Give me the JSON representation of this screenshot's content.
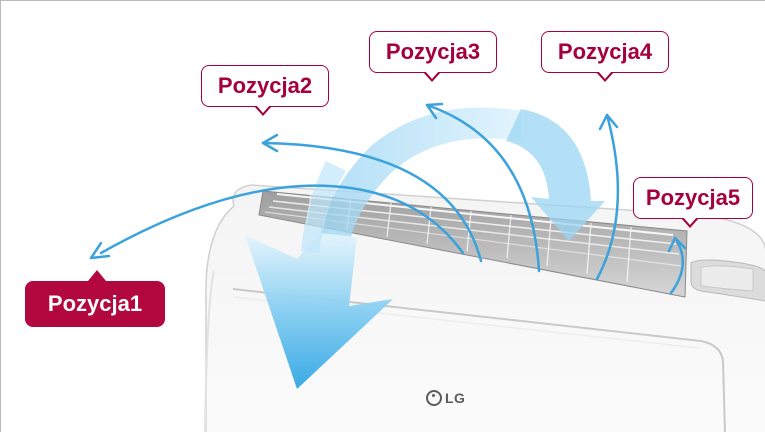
{
  "labels": {
    "position1": "Pozycja1",
    "position2": "Pozycja2",
    "position3": "Pozycja3",
    "position4": "Pozycja4",
    "position5": "Pozycja5"
  },
  "logo": {
    "text": "LG"
  },
  "colors": {
    "accent": "#b2083f",
    "label_border": "#a5003d",
    "airflow_light": "#e6f5fd",
    "airflow_dark": "#2fa6e3",
    "direction_line": "#3ba2dc"
  },
  "icons": [
    "lg-logo-icon",
    "airflow-arrow-icon",
    "direction-arrow-icon"
  ]
}
